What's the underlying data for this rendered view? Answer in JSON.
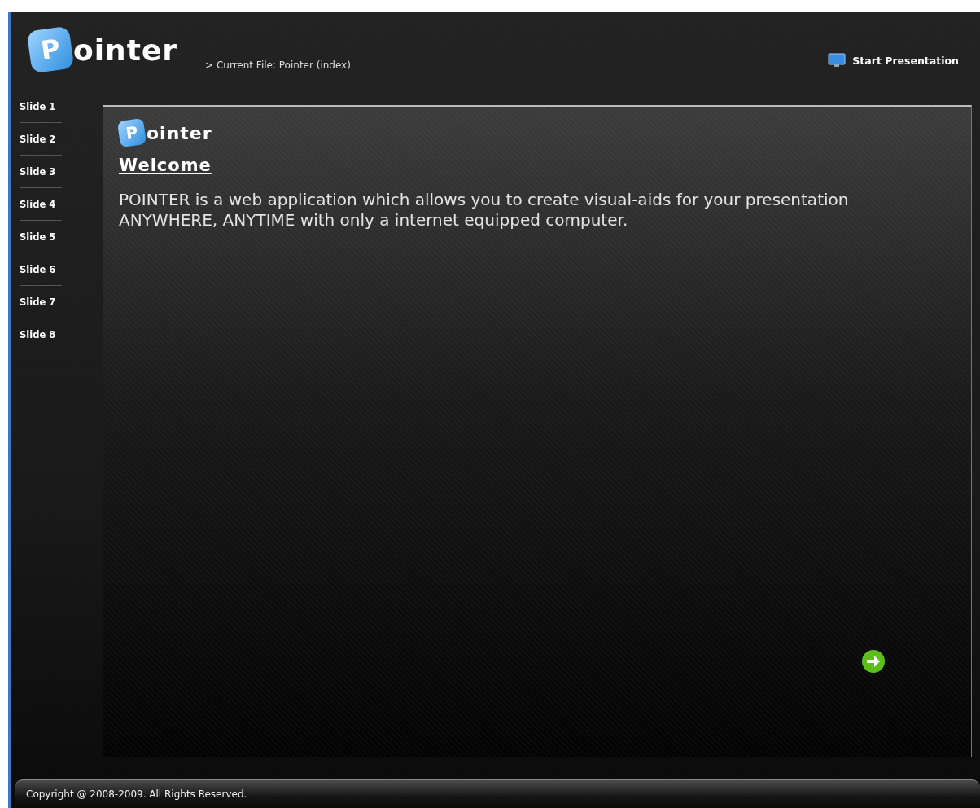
{
  "header": {
    "logo": {
      "badge_letter": "P",
      "text": "ointer"
    },
    "breadcrumb": "> Current File: Pointer (index)",
    "start_button": "Start Presentation"
  },
  "sidebar": {
    "items": [
      {
        "label": "Slide 1"
      },
      {
        "label": "Slide 2"
      },
      {
        "label": "Slide 3"
      },
      {
        "label": "Slide 4"
      },
      {
        "label": "Slide 5"
      },
      {
        "label": "Slide 6"
      },
      {
        "label": "Slide 7"
      },
      {
        "label": "Slide 8"
      }
    ]
  },
  "slide": {
    "logo": {
      "badge_letter": "P",
      "text": "ointer"
    },
    "heading": "Welcome",
    "body": "POINTER is a web application which allows you to create visual-aids for your presentation ANYWHERE, ANYTIME with only a internet equipped computer."
  },
  "footer": {
    "copyright": "Copyright @ 2008-2009. All Rights Reserved."
  }
}
